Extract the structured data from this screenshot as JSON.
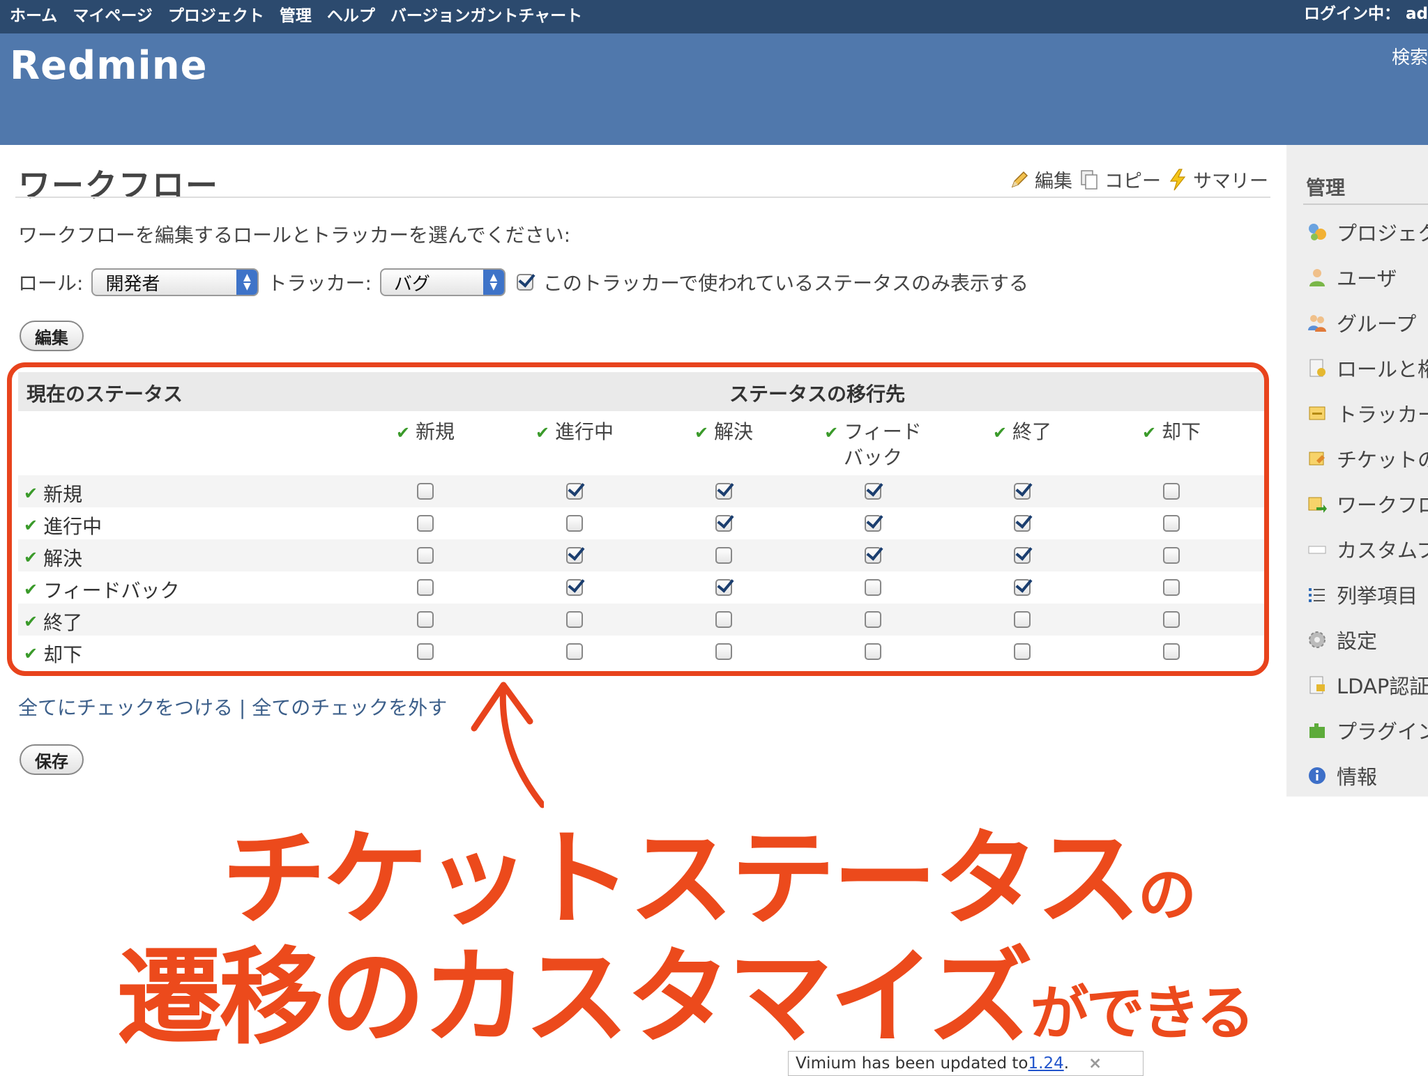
{
  "top_menu": {
    "items": [
      "ホーム",
      "マイページ",
      "プロジェクト",
      "管理",
      "ヘルプ",
      "バージョンガントチャート"
    ],
    "login": "ログイン中： ad"
  },
  "header": {
    "title": "Redmine",
    "search_label": "検索"
  },
  "page": {
    "title": "ワークフロー",
    "contextual": {
      "edit": "編集",
      "copy": "コピー",
      "summary": "サマリー"
    },
    "intro": "ワークフローを編集するロールとトラッカーを選んでください:",
    "role_label": "ロール:",
    "role_value": "開発者",
    "tracker_label": "トラッカー:",
    "tracker_value": "バグ",
    "used_only_label": "このトラッカーで使われているステータスのみ表示する",
    "edit_button": "編集",
    "check_all": "全てにチェックをつける",
    "separator": "|",
    "uncheck_all": "全てのチェックを外す",
    "save_button": "保存"
  },
  "workflow_table": {
    "current_status_header": "現在のステータス",
    "new_status_header": "ステータスの移行先",
    "columns": [
      "新規",
      "進行中",
      "解決",
      "フィードバック",
      "終了",
      "却下"
    ],
    "column_display": [
      "新規",
      "進行中",
      "解決",
      "フィード\nバック",
      "終了",
      "却下"
    ],
    "rows": [
      {
        "status": "新規",
        "checks": [
          false,
          true,
          true,
          true,
          true,
          false
        ]
      },
      {
        "status": "進行中",
        "checks": [
          false,
          false,
          true,
          true,
          true,
          false
        ]
      },
      {
        "status": "解決",
        "checks": [
          false,
          true,
          false,
          true,
          true,
          false
        ]
      },
      {
        "status": "フィードバック",
        "checks": [
          false,
          true,
          true,
          false,
          true,
          false
        ]
      },
      {
        "status": "終了",
        "checks": [
          false,
          false,
          false,
          false,
          false,
          false
        ]
      },
      {
        "status": "却下",
        "checks": [
          false,
          false,
          false,
          false,
          false,
          false
        ]
      }
    ]
  },
  "sidebar": {
    "heading": "管理",
    "items": [
      {
        "label": "プロジェク",
        "icon": "projects-icon"
      },
      {
        "label": "ユーザ",
        "icon": "user-icon"
      },
      {
        "label": "グループ",
        "icon": "group-icon"
      },
      {
        "label": "ロールと権",
        "icon": "role-icon"
      },
      {
        "label": "トラッカー",
        "icon": "tracker-icon"
      },
      {
        "label": "チケットの",
        "icon": "issue-status-icon"
      },
      {
        "label": "ワークフロ",
        "icon": "workflow-icon"
      },
      {
        "label": "カスタムフ",
        "icon": "custom-field-icon"
      },
      {
        "label": "列挙項目",
        "icon": "list-icon"
      },
      {
        "label": "設定",
        "icon": "gear-icon"
      },
      {
        "label": "LDAP認証",
        "icon": "ldap-icon"
      },
      {
        "label": "プラグイン",
        "icon": "plugin-icon"
      },
      {
        "label": "情報",
        "icon": "info-icon"
      }
    ]
  },
  "annotation": {
    "line1_main": "チケットステータス",
    "line1_suffix": "の",
    "line2_main": "遷移のカスタマイズ",
    "line2_suffix": "ができる"
  },
  "vimium": {
    "text": "Vimium has been updated to ",
    "version": "1.24",
    "tail": ".",
    "close": "×"
  },
  "colors": {
    "accent": "#ec4a1c",
    "header": "#5078ac",
    "top_menu": "#2c4a6e"
  }
}
